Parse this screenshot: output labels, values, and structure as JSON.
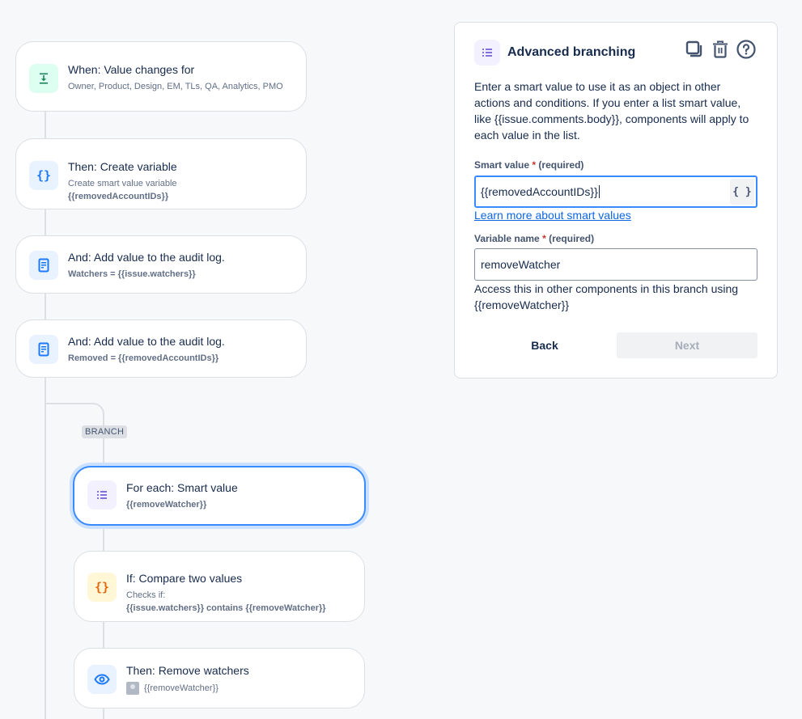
{
  "flow": {
    "nodes": [
      {
        "id": "trigger",
        "title": "When: Value changes for",
        "sub": "Owner, Product, Design, EM, TLs, QA, Analytics, PMO",
        "icon": "download-icon",
        "iconColor": "#1f845a",
        "iconBg": "#dcfff1"
      },
      {
        "id": "create-variable",
        "title": "Then: Create variable",
        "sub": "Create smart value variable",
        "sub2": "{{removedAccountIDs}}",
        "icon": "braces-icon",
        "iconColor": "#1d7afc",
        "iconBg": "#e9f2ff"
      },
      {
        "id": "audit-log-1",
        "title": "And: Add value to the audit log.",
        "sub": "Watchers = {{issue.watchers}}",
        "icon": "document-icon",
        "iconColor": "#1d7afc",
        "iconBg": "#e9f2ff"
      },
      {
        "id": "audit-log-2",
        "title": "And: Add value to the audit log.",
        "sub": "Removed = {{removedAccountIDs}}",
        "icon": "document-icon",
        "iconColor": "#1d7afc",
        "iconBg": "#e9f2ff"
      },
      {
        "id": "for-each",
        "title": "For each: Smart value",
        "sub": "{{removeWatcher}}",
        "icon": "list-icon",
        "iconColor": "#8270db",
        "iconBg": "#f3f0ff",
        "selected": true
      },
      {
        "id": "compare",
        "title": "If: Compare two values",
        "sub": "Checks if:",
        "sub2": "{{issue.watchers}} contains {{removeWatcher}}",
        "icon": "braces-icon",
        "iconColor": "#e56910",
        "iconBg": "#fff7d6"
      },
      {
        "id": "remove-watchers",
        "title": "Then: Remove watchers",
        "sub": "{{removeWatcher}}",
        "icon": "eye-icon",
        "iconColor": "#1d7afc",
        "iconBg": "#e9f2ff"
      }
    ],
    "branch_label": "BRANCH"
  },
  "panel": {
    "title": "Advanced branching",
    "actions": [
      "duplicate-icon",
      "trash-icon",
      "help-icon"
    ],
    "description": "Enter a smart value to use it as an object in other actions and conditions. If you enter a list smart value, like {{issue.comments.body}}, components will apply to each value in the list.",
    "smart_value": {
      "label": "Smart value",
      "required_marker": "*",
      "required_text": "(required)",
      "value": "{{removedAccountIDs}}",
      "button": "{ }"
    },
    "learn_more": "Learn more about smart values",
    "variable_name": {
      "label": "Variable name",
      "required_marker": "*",
      "required_text": "(required)",
      "value": "removeWatcher"
    },
    "help_text": "Access this in other components in this branch using {{removeWatcher}}",
    "buttons": {
      "back": "Back",
      "next": "Next"
    }
  }
}
